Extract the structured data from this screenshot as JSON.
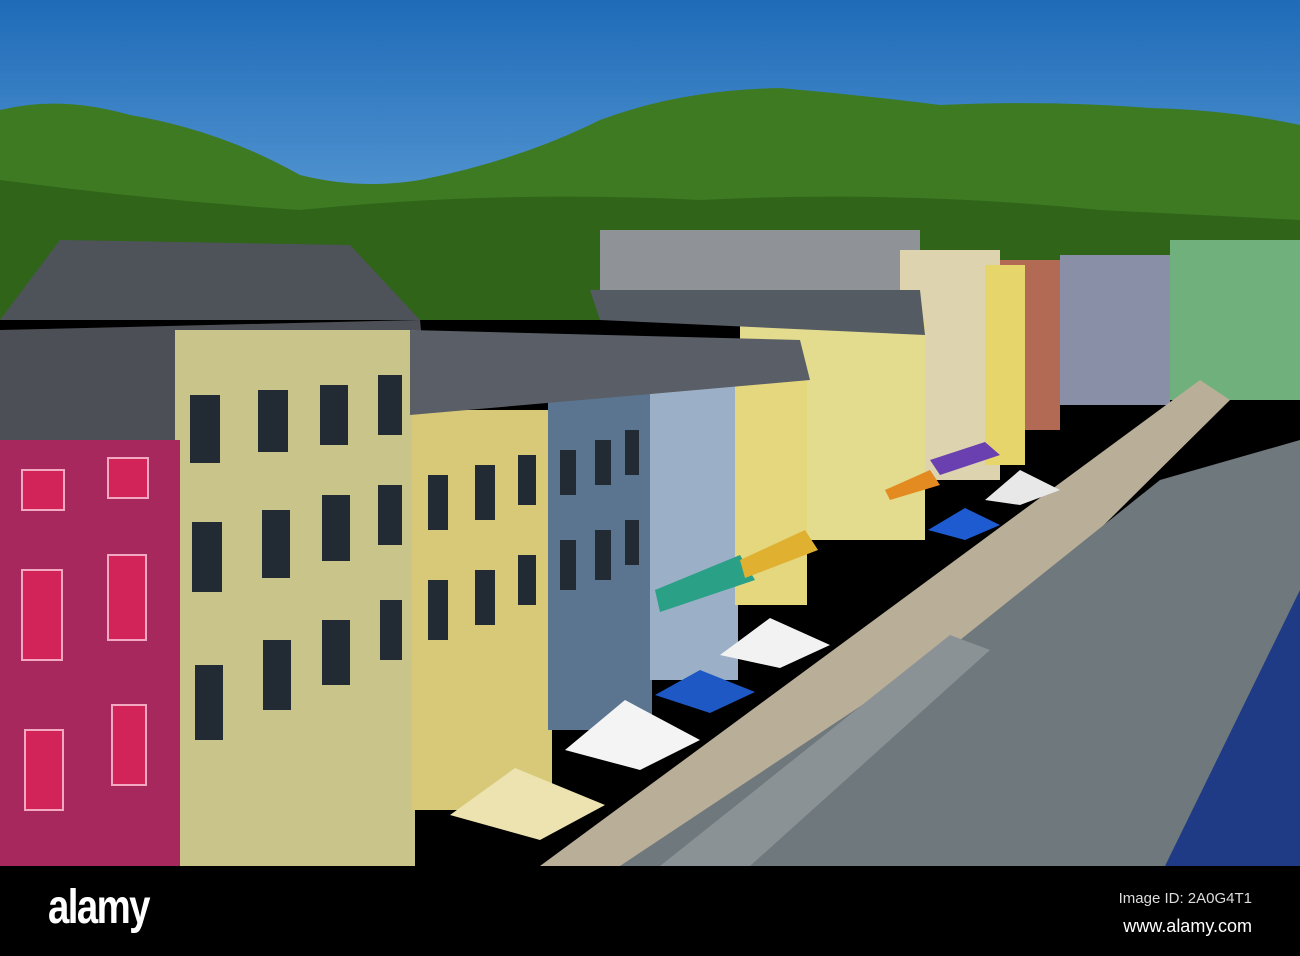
{
  "watermark": {
    "logo": "alamy",
    "image_id": "Image ID: 2A0G4T1",
    "url": "www.alamy.com"
  },
  "colors": {
    "sky": "#2f7fc7",
    "hills": "#3d7a22",
    "roof": "#707a7e",
    "magenta_building": "#a6285c",
    "cream_building": "#c9c48a",
    "blue_building": "#5b7591",
    "yellow_building": "#e3d27a"
  }
}
